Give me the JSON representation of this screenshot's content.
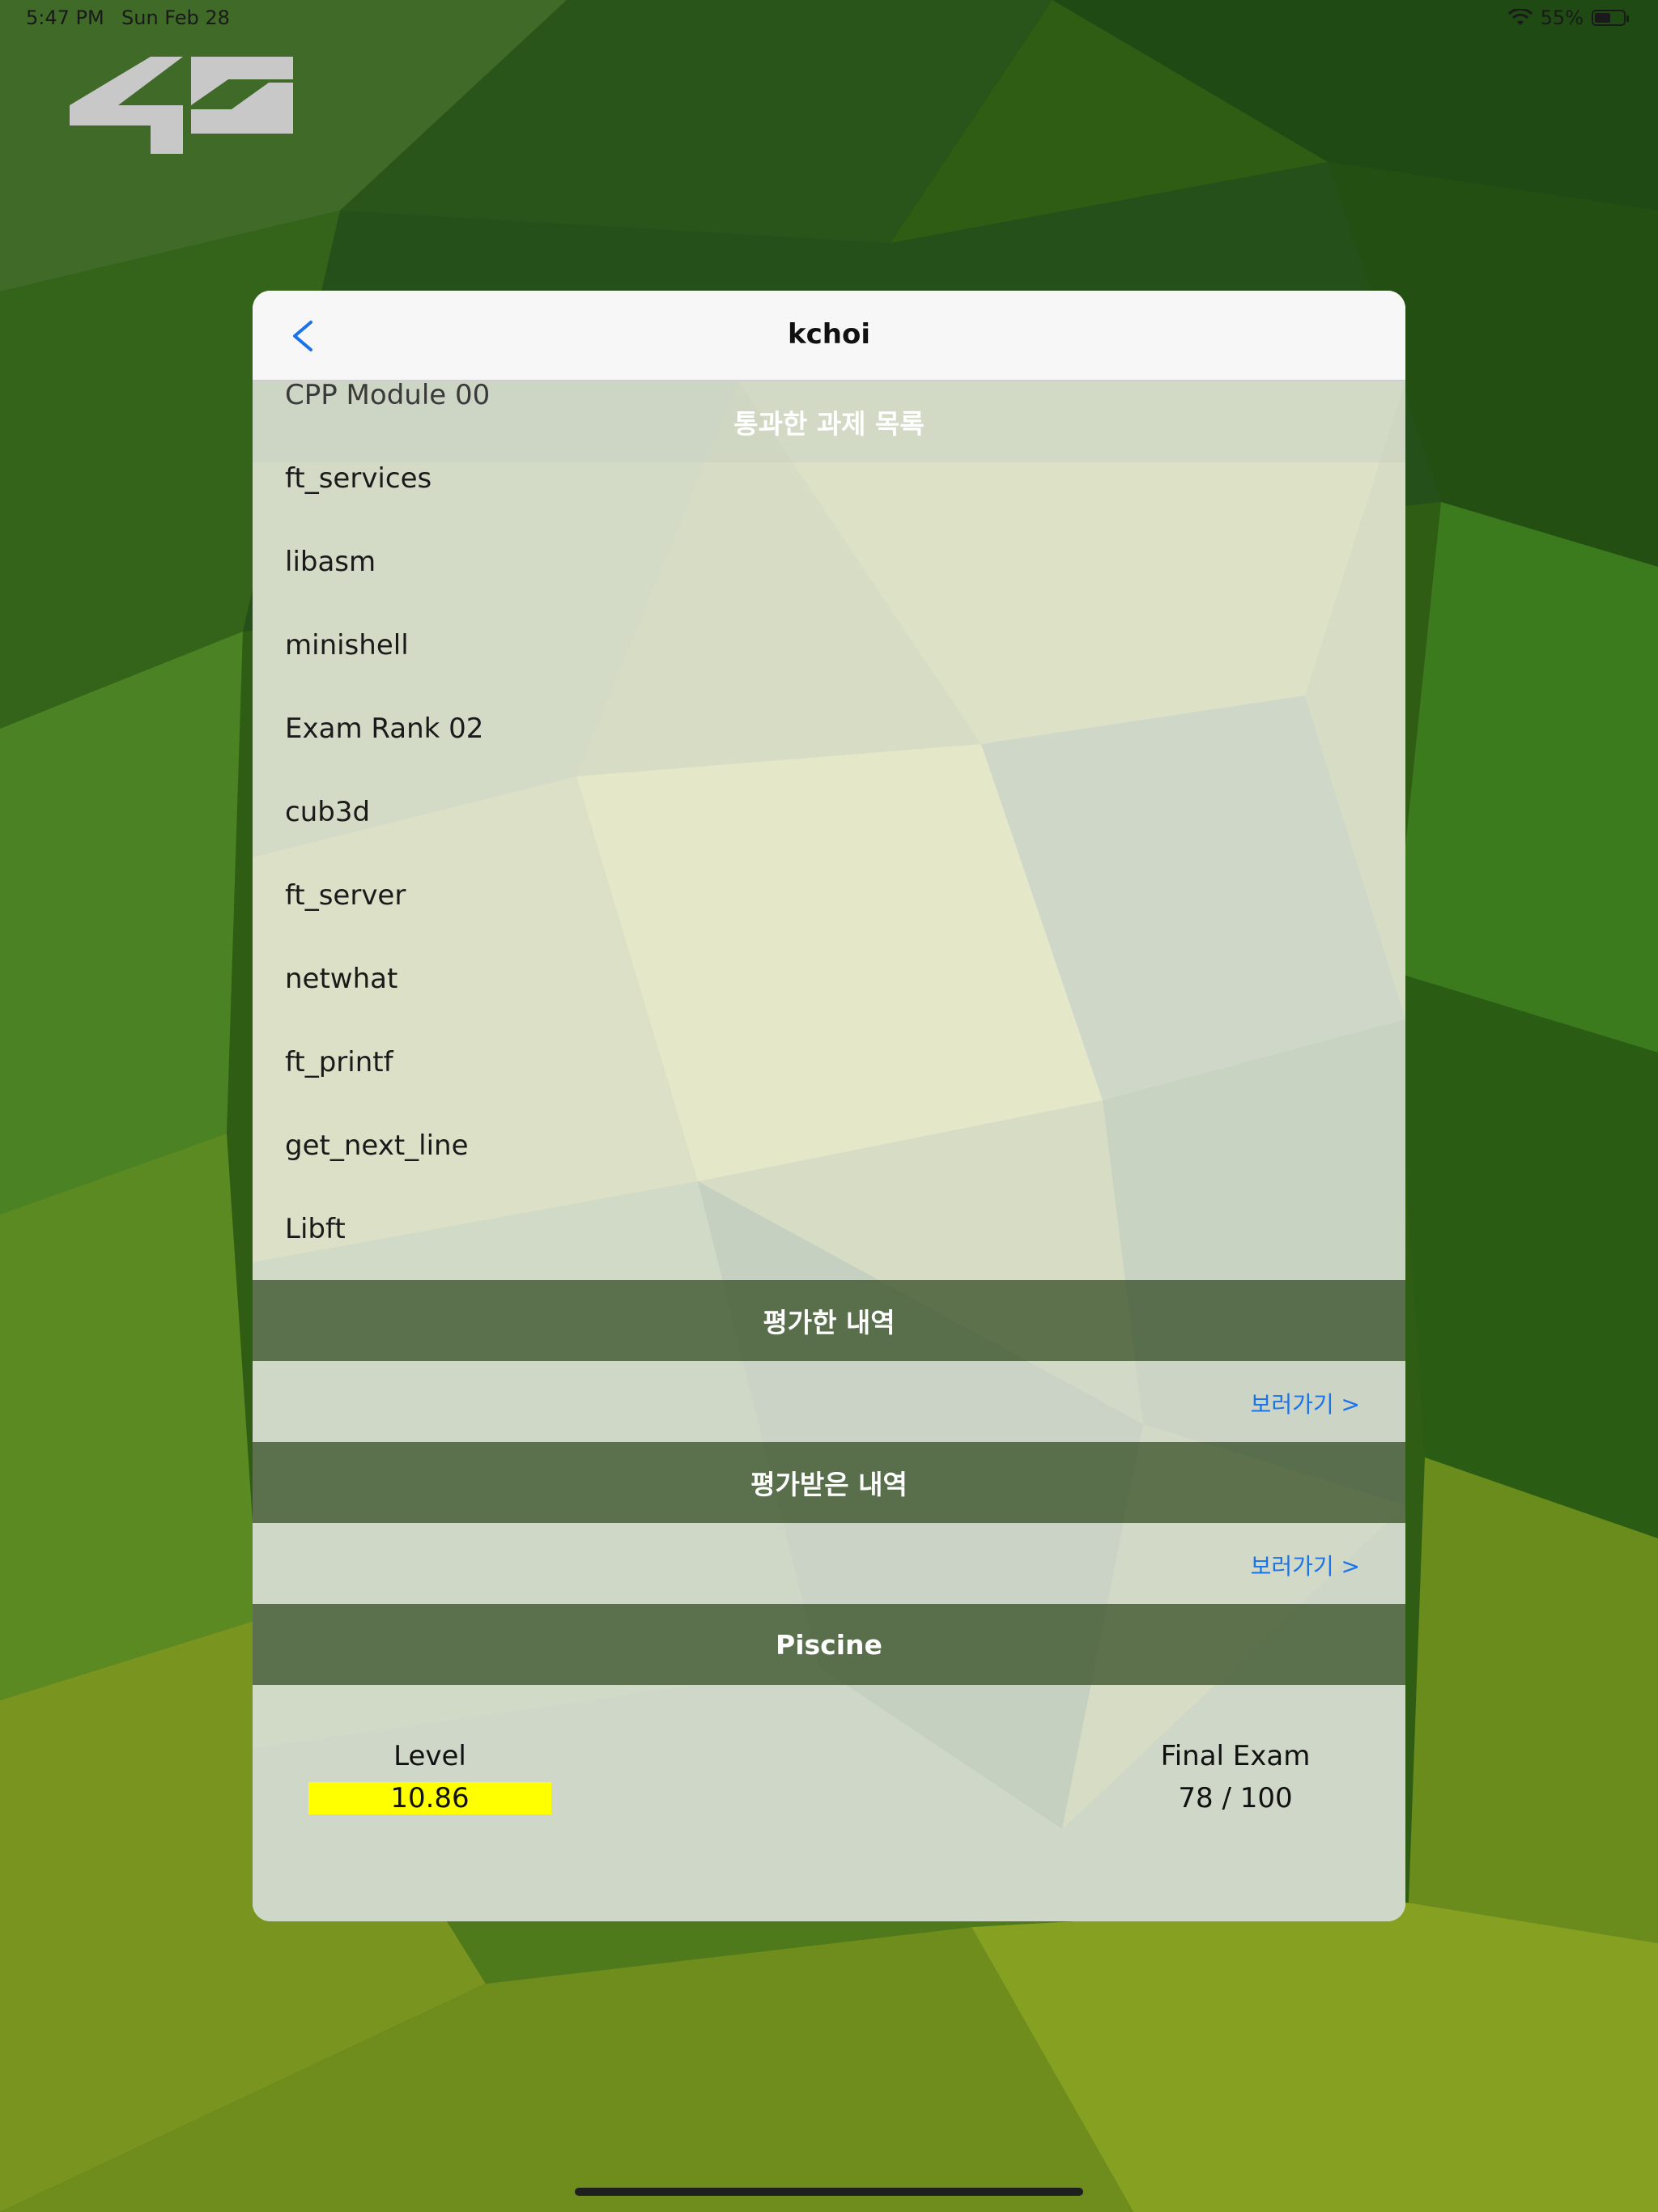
{
  "status_bar": {
    "time": "5:47 PM",
    "date": "Sun Feb 28",
    "battery": "55%",
    "battery_level": 0.55
  },
  "logo": {
    "icon": "42-logo"
  },
  "nav": {
    "title": "kchoi",
    "back_label": "<"
  },
  "projects_section": {
    "header": "통과한 과제 목록",
    "items": [
      "CPP Module 00",
      "ft_services",
      "libasm",
      "minishell",
      "Exam Rank 02",
      "cub3d",
      "ft_server",
      "netwhat",
      "ft_printf",
      "get_next_line",
      "Libft"
    ]
  },
  "evaluated_section": {
    "header": "평가한 내역",
    "link": "보러가기 >"
  },
  "received_section": {
    "header": "평가받은 내역",
    "link": "보러가기 >"
  },
  "piscine_section": {
    "header": "Piscine",
    "level_label": "Level",
    "level_value": "10.86",
    "exam_label": "Final Exam",
    "exam_value": "78 / 100"
  },
  "colors": {
    "accent": "#1a73e8",
    "level_highlight": "#ffff00",
    "dark_header": "#3a522a"
  }
}
